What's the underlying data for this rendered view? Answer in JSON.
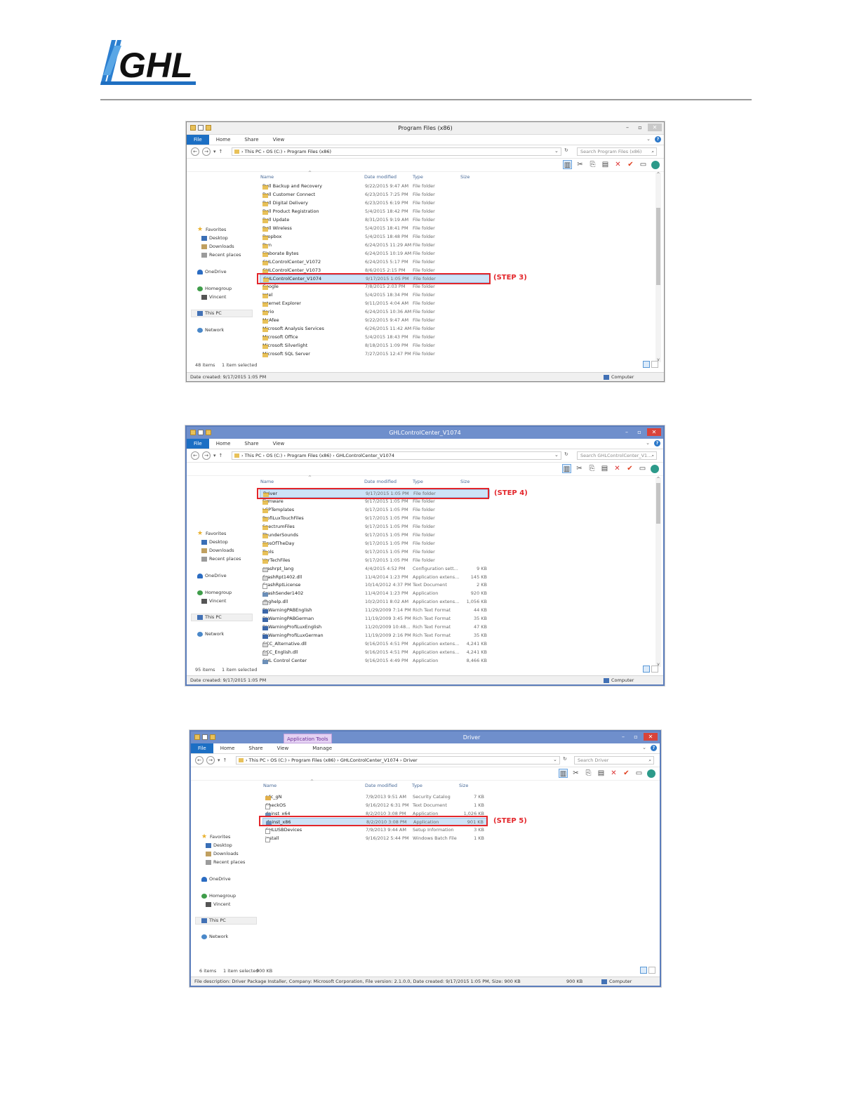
{
  "logo": {
    "text": "GHL"
  },
  "windows": [
    {
      "title": "Program Files (x86)",
      "ribbon_tabs": [
        "File",
        "Home",
        "Share",
        "View"
      ],
      "breadcrumb": [
        "This PC",
        "OS (C:)",
        "Program Files (x86)"
      ],
      "search_placeholder": "Search Program Files (x86)",
      "columns": {
        "name": "Name",
        "date": "Date modified",
        "type": "Type",
        "size": "Size"
      },
      "nav": {
        "favorites": "Favorites",
        "desktop": "Desktop",
        "downloads": "Downloads",
        "recent": "Recent places",
        "onedrive": "OneDrive",
        "homegroup": "Homegroup",
        "user": "Vincent",
        "thispc": "This PC",
        "network": "Network"
      },
      "rows": [
        {
          "name": "Dell Backup and Recovery",
          "date": "9/22/2015 9:47 AM",
          "type": "File folder",
          "size": ""
        },
        {
          "name": "Dell Customer Connect",
          "date": "6/23/2015 7:25 PM",
          "type": "File folder",
          "size": ""
        },
        {
          "name": "Dell Digital Delivery",
          "date": "6/23/2015 6:19 PM",
          "type": "File folder",
          "size": ""
        },
        {
          "name": "Dell Product Registration",
          "date": "5/4/2015 18:42 PM",
          "type": "File folder",
          "size": ""
        },
        {
          "name": "Dell Update",
          "date": "8/31/2015 9:19 AM",
          "type": "File folder",
          "size": ""
        },
        {
          "name": "Dell Wireless",
          "date": "5/4/2015 18:41 PM",
          "type": "File folder",
          "size": ""
        },
        {
          "name": "Dropbox",
          "date": "5/4/2015 18:48 PM",
          "type": "File folder",
          "size": ""
        },
        {
          "name": "Dyn",
          "date": "6/24/2015 11:29 AM",
          "type": "File folder",
          "size": ""
        },
        {
          "name": "Elaborate Bytes",
          "date": "6/24/2015 10:19 AM",
          "type": "File folder",
          "size": ""
        },
        {
          "name": "GHLControlCenter_V1072",
          "date": "6/24/2015 5:17 PM",
          "type": "File folder",
          "size": ""
        },
        {
          "name": "GHLControlCenter_V1073",
          "date": "8/6/2015 2:15 PM",
          "type": "File folder",
          "size": ""
        },
        {
          "name": "GHLControlCenter_V1074",
          "date": "9/17/2015 1:05 PM",
          "type": "File folder",
          "size": ""
        },
        {
          "name": "Google",
          "date": "7/8/2015 2:03 PM",
          "type": "File folder",
          "size": ""
        },
        {
          "name": "Intel",
          "date": "5/4/2015 18:34 PM",
          "type": "File folder",
          "size": ""
        },
        {
          "name": "Internet Explorer",
          "date": "9/11/2015 4:04 AM",
          "type": "File folder",
          "size": ""
        },
        {
          "name": "Kerio",
          "date": "6/24/2015 10:36 AM",
          "type": "File folder",
          "size": ""
        },
        {
          "name": "McAfee",
          "date": "9/22/2015 9:47 AM",
          "type": "File folder",
          "size": ""
        },
        {
          "name": "Microsoft Analysis Services",
          "date": "6/26/2015 11:42 AM",
          "type": "File folder",
          "size": ""
        },
        {
          "name": "Microsoft Office",
          "date": "5/4/2015 18:43 PM",
          "type": "File folder",
          "size": ""
        },
        {
          "name": "Microsoft Silverlight",
          "date": "8/18/2015 1:09 PM",
          "type": "File folder",
          "size": ""
        },
        {
          "name": "Microsoft SQL Server",
          "date": "7/27/2015 12:47 PM",
          "type": "File folder",
          "size": ""
        }
      ],
      "status_items": "48 items",
      "status_selected": "1 item selected",
      "details": "Date created: 9/17/2015 1:05 PM",
      "details_right": "Computer",
      "step": "(STEP 3)"
    },
    {
      "title": "GHLControlCenter_V1074",
      "ribbon_tabs": [
        "File",
        "Home",
        "Share",
        "View"
      ],
      "breadcrumb": [
        "This PC",
        "OS (C:)",
        "Program Files (x86)",
        "GHLControlCenter_V1074"
      ],
      "search_placeholder": "Search GHLControlCenter_V1...",
      "columns": {
        "name": "Name",
        "date": "Date modified",
        "type": "Type",
        "size": "Size"
      },
      "nav": {
        "favorites": "Favorites",
        "desktop": "Desktop",
        "downloads": "Downloads",
        "recent": "Recent places",
        "onedrive": "OneDrive",
        "homegroup": "Homegroup",
        "user": "Vincent",
        "thispc": "This PC",
        "network": "Network"
      },
      "rows": [
        {
          "name": "Driver",
          "date": "9/17/2015 1:05 PM",
          "type": "File folder",
          "size": "",
          "icon": "folder"
        },
        {
          "name": "Firmware",
          "date": "9/17/2015 1:05 PM",
          "type": "File folder",
          "size": "",
          "icon": "folder"
        },
        {
          "name": "LCPTemplates",
          "date": "9/17/2015 1:05 PM",
          "type": "File folder",
          "size": "",
          "icon": "folder"
        },
        {
          "name": "ProfiLuxTouchFiles",
          "date": "9/17/2015 1:05 PM",
          "type": "File folder",
          "size": "",
          "icon": "folder"
        },
        {
          "name": "SpectrumFiles",
          "date": "9/17/2015 1:05 PM",
          "type": "File folder",
          "size": "",
          "icon": "folder"
        },
        {
          "name": "ThunderSounds",
          "date": "9/17/2015 1:05 PM",
          "type": "File folder",
          "size": "",
          "icon": "folder"
        },
        {
          "name": "TipsOfTheDay",
          "date": "9/17/2015 1:05 PM",
          "type": "File folder",
          "size": "",
          "icon": "folder"
        },
        {
          "name": "Tools",
          "date": "9/17/2015 1:05 PM",
          "type": "File folder",
          "size": "",
          "icon": "folder"
        },
        {
          "name": "VorTechFiles",
          "date": "9/17/2015 1:05 PM",
          "type": "File folder",
          "size": "",
          "icon": "folder"
        },
        {
          "name": "crashrpt_lang",
          "date": "4/4/2015 4:52 PM",
          "type": "Configuration sett...",
          "size": "9 KB",
          "icon": "dll"
        },
        {
          "name": "CrashRpt1402.dll",
          "date": "11/4/2014 1:23 PM",
          "type": "Application extens...",
          "size": "145 KB",
          "icon": "dll"
        },
        {
          "name": "CrashRptLicense",
          "date": "10/14/2012 4:37 PM",
          "type": "Text Document",
          "size": "2 KB",
          "icon": "file"
        },
        {
          "name": "CrashSender1402",
          "date": "11/4/2014 1:23 PM",
          "type": "Application",
          "size": "920 KB",
          "icon": "app"
        },
        {
          "name": "dbghelp.dll",
          "date": "10/2/2011 8:02 AM",
          "type": "Application extens...",
          "size": "1,056 KB",
          "icon": "dll"
        },
        {
          "name": "DLWarningPABEnglish",
          "date": "11/29/2009 7:14 PM",
          "type": "Rich Text Format",
          "size": "44 KB",
          "icon": "rtf"
        },
        {
          "name": "DLWarningPABGerman",
          "date": "11/19/2009 3:45 PM",
          "type": "Rich Text Format",
          "size": "35 KB",
          "icon": "rtf"
        },
        {
          "name": "DLWarningProfiLuxEnglish",
          "date": "11/20/2009 10:48...",
          "type": "Rich Text Format",
          "size": "47 KB",
          "icon": "rtf"
        },
        {
          "name": "DLWarningProfiLuxGerman",
          "date": "11/19/2009 2:16 PM",
          "type": "Rich Text Format",
          "size": "35 KB",
          "icon": "rtf"
        },
        {
          "name": "GCC_Alternative.dll",
          "date": "9/16/2015 4:51 PM",
          "type": "Application extens...",
          "size": "4,241 KB",
          "icon": "dll"
        },
        {
          "name": "GCC_English.dll",
          "date": "9/16/2015 4:51 PM",
          "type": "Application extens...",
          "size": "4,241 KB",
          "icon": "dll"
        },
        {
          "name": "GHL Control Center",
          "date": "9/16/2015 4:49 PM",
          "type": "Application",
          "size": "8,466 KB",
          "icon": "app"
        }
      ],
      "status_items": "95 items",
      "status_selected": "1 item selected",
      "details": "Date created: 9/17/2015 1:05 PM",
      "details_right": "Computer",
      "step": "(STEP 4)"
    },
    {
      "title": "Driver",
      "context_tab": "Application Tools",
      "ribbon_tabs": [
        "File",
        "Home",
        "Share",
        "View",
        "Manage"
      ],
      "breadcrumb": [
        "This PC",
        "OS (C:)",
        "Program Files (x86)",
        "GHLControlCenter_V1074",
        "Driver"
      ],
      "search_placeholder": "Search Driver",
      "columns": {
        "name": "Name",
        "date": "Date modified",
        "type": "Type",
        "size": "Size"
      },
      "nav": {
        "favorites": "Favorites",
        "desktop": "Desktop",
        "downloads": "Downloads",
        "recent": "Recent places",
        "onedrive": "OneDrive",
        "homegroup": "Homegroup",
        "user": "Vincent",
        "thispc": "This PC",
        "network": "Network"
      },
      "rows": [
        {
          "name": "cdc_gN",
          "date": "7/9/2013 9:51 AM",
          "type": "Security Catalog",
          "size": "7 KB",
          "icon": "cert"
        },
        {
          "name": "CheckOS",
          "date": "9/16/2012 6:31 PM",
          "type": "Text Document",
          "size": "1 KB",
          "icon": "file"
        },
        {
          "name": "dpinst_x64",
          "date": "8/2/2010 3:08 PM",
          "type": "Application",
          "size": "1,026 KB",
          "icon": "app"
        },
        {
          "name": "dpinst_x86",
          "date": "8/2/2010 3:08 PM",
          "type": "Application",
          "size": "901 KB",
          "icon": "app"
        },
        {
          "name": "GHLUSBDevices",
          "date": "7/9/2013 9:44 AM",
          "type": "Setup Information",
          "size": "3 KB",
          "icon": "file"
        },
        {
          "name": "install",
          "date": "9/16/2012 5:44 PM",
          "type": "Windows Batch File",
          "size": "1 KB",
          "icon": "file"
        }
      ],
      "status_items": "6 items",
      "status_selected": "1 item selected",
      "status_size": "900 KB",
      "details": "File description: Driver Package Installer, Company: Microsoft Corporation, File version: 2.1.0.0, Date created: 9/17/2015 1:05 PM, Size: 900 KB",
      "details_size": "900 KB",
      "details_right": "Computer",
      "step": "(STEP 5)"
    }
  ]
}
